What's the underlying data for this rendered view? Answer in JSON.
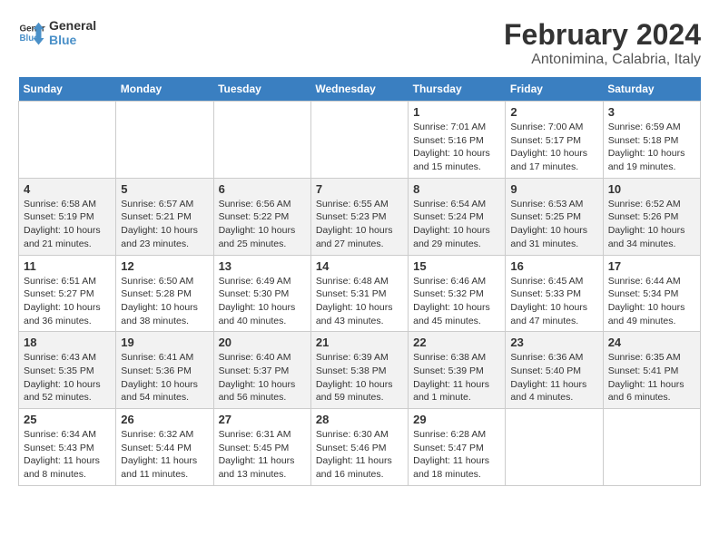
{
  "header": {
    "logo_line1": "General",
    "logo_line2": "Blue",
    "title": "February 2024",
    "subtitle": "Antonimina, Calabria, Italy"
  },
  "calendar": {
    "days_of_week": [
      "Sunday",
      "Monday",
      "Tuesday",
      "Wednesday",
      "Thursday",
      "Friday",
      "Saturday"
    ],
    "weeks": [
      [
        {
          "day": "",
          "info": ""
        },
        {
          "day": "",
          "info": ""
        },
        {
          "day": "",
          "info": ""
        },
        {
          "day": "",
          "info": ""
        },
        {
          "day": "1",
          "info": "Sunrise: 7:01 AM\nSunset: 5:16 PM\nDaylight: 10 hours\nand 15 minutes."
        },
        {
          "day": "2",
          "info": "Sunrise: 7:00 AM\nSunset: 5:17 PM\nDaylight: 10 hours\nand 17 minutes."
        },
        {
          "day": "3",
          "info": "Sunrise: 6:59 AM\nSunset: 5:18 PM\nDaylight: 10 hours\nand 19 minutes."
        }
      ],
      [
        {
          "day": "4",
          "info": "Sunrise: 6:58 AM\nSunset: 5:19 PM\nDaylight: 10 hours\nand 21 minutes."
        },
        {
          "day": "5",
          "info": "Sunrise: 6:57 AM\nSunset: 5:21 PM\nDaylight: 10 hours\nand 23 minutes."
        },
        {
          "day": "6",
          "info": "Sunrise: 6:56 AM\nSunset: 5:22 PM\nDaylight: 10 hours\nand 25 minutes."
        },
        {
          "day": "7",
          "info": "Sunrise: 6:55 AM\nSunset: 5:23 PM\nDaylight: 10 hours\nand 27 minutes."
        },
        {
          "day": "8",
          "info": "Sunrise: 6:54 AM\nSunset: 5:24 PM\nDaylight: 10 hours\nand 29 minutes."
        },
        {
          "day": "9",
          "info": "Sunrise: 6:53 AM\nSunset: 5:25 PM\nDaylight: 10 hours\nand 31 minutes."
        },
        {
          "day": "10",
          "info": "Sunrise: 6:52 AM\nSunset: 5:26 PM\nDaylight: 10 hours\nand 34 minutes."
        }
      ],
      [
        {
          "day": "11",
          "info": "Sunrise: 6:51 AM\nSunset: 5:27 PM\nDaylight: 10 hours\nand 36 minutes."
        },
        {
          "day": "12",
          "info": "Sunrise: 6:50 AM\nSunset: 5:28 PM\nDaylight: 10 hours\nand 38 minutes."
        },
        {
          "day": "13",
          "info": "Sunrise: 6:49 AM\nSunset: 5:30 PM\nDaylight: 10 hours\nand 40 minutes."
        },
        {
          "day": "14",
          "info": "Sunrise: 6:48 AM\nSunset: 5:31 PM\nDaylight: 10 hours\nand 43 minutes."
        },
        {
          "day": "15",
          "info": "Sunrise: 6:46 AM\nSunset: 5:32 PM\nDaylight: 10 hours\nand 45 minutes."
        },
        {
          "day": "16",
          "info": "Sunrise: 6:45 AM\nSunset: 5:33 PM\nDaylight: 10 hours\nand 47 minutes."
        },
        {
          "day": "17",
          "info": "Sunrise: 6:44 AM\nSunset: 5:34 PM\nDaylight: 10 hours\nand 49 minutes."
        }
      ],
      [
        {
          "day": "18",
          "info": "Sunrise: 6:43 AM\nSunset: 5:35 PM\nDaylight: 10 hours\nand 52 minutes."
        },
        {
          "day": "19",
          "info": "Sunrise: 6:41 AM\nSunset: 5:36 PM\nDaylight: 10 hours\nand 54 minutes."
        },
        {
          "day": "20",
          "info": "Sunrise: 6:40 AM\nSunset: 5:37 PM\nDaylight: 10 hours\nand 56 minutes."
        },
        {
          "day": "21",
          "info": "Sunrise: 6:39 AM\nSunset: 5:38 PM\nDaylight: 10 hours\nand 59 minutes."
        },
        {
          "day": "22",
          "info": "Sunrise: 6:38 AM\nSunset: 5:39 PM\nDaylight: 11 hours\nand 1 minute."
        },
        {
          "day": "23",
          "info": "Sunrise: 6:36 AM\nSunset: 5:40 PM\nDaylight: 11 hours\nand 4 minutes."
        },
        {
          "day": "24",
          "info": "Sunrise: 6:35 AM\nSunset: 5:41 PM\nDaylight: 11 hours\nand 6 minutes."
        }
      ],
      [
        {
          "day": "25",
          "info": "Sunrise: 6:34 AM\nSunset: 5:43 PM\nDaylight: 11 hours\nand 8 minutes."
        },
        {
          "day": "26",
          "info": "Sunrise: 6:32 AM\nSunset: 5:44 PM\nDaylight: 11 hours\nand 11 minutes."
        },
        {
          "day": "27",
          "info": "Sunrise: 6:31 AM\nSunset: 5:45 PM\nDaylight: 11 hours\nand 13 minutes."
        },
        {
          "day": "28",
          "info": "Sunrise: 6:30 AM\nSunset: 5:46 PM\nDaylight: 11 hours\nand 16 minutes."
        },
        {
          "day": "29",
          "info": "Sunrise: 6:28 AM\nSunset: 5:47 PM\nDaylight: 11 hours\nand 18 minutes."
        },
        {
          "day": "",
          "info": ""
        },
        {
          "day": "",
          "info": ""
        }
      ]
    ]
  }
}
